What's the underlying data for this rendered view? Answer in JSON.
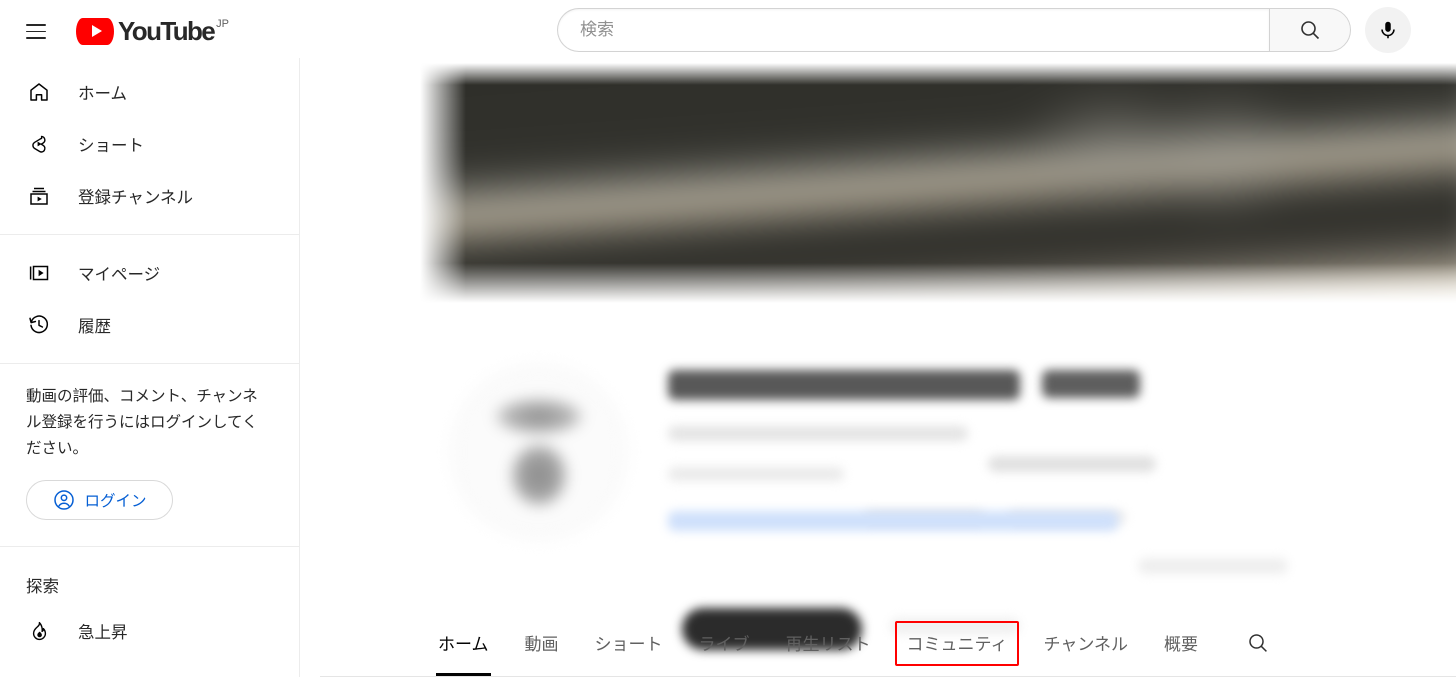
{
  "topbar": {
    "menu_icon": "hamburger-menu-icon",
    "logo_word": "YouTube",
    "logo_country": "JP",
    "search": {
      "placeholder": "検索",
      "value": "",
      "search_icon": "search-icon",
      "mic_icon": "microphone-icon"
    }
  },
  "sidebar": {
    "primary_items": [
      {
        "label": "ホーム",
        "icon": "home-icon"
      },
      {
        "label": "ショート",
        "icon": "shorts-icon"
      },
      {
        "label": "登録チャンネル",
        "icon": "subscriptions-icon"
      }
    ],
    "secondary_items": [
      {
        "label": "マイページ",
        "icon": "you-library-icon"
      },
      {
        "label": "履歴",
        "icon": "history-clock-icon"
      }
    ],
    "signin": {
      "message": "動画の評価、コメント、チャンネル登録を行うにはログインしてください。",
      "button_label": "ログイン",
      "button_icon": "account-circle-icon",
      "accent_color": "#065fd4"
    },
    "explore": {
      "section_title": "探索",
      "items": [
        {
          "label": "急上昇",
          "icon": "trending-flame-icon"
        }
      ]
    }
  },
  "channel": {
    "banner_alt": "blurred-channel-banner",
    "avatar_alt": "blurred-channel-avatar",
    "name_redacted": true,
    "subscribe_button_redacted": true
  },
  "tabs": {
    "items": [
      {
        "label": "ホーム",
        "active": true,
        "highlighted": false
      },
      {
        "label": "動画",
        "active": false,
        "highlighted": false
      },
      {
        "label": "ショート",
        "active": false,
        "highlighted": false
      },
      {
        "label": "ライブ",
        "active": false,
        "highlighted": false
      },
      {
        "label": "再生リスト",
        "active": false,
        "highlighted": false
      },
      {
        "label": "コミュニティ",
        "active": false,
        "highlighted": true
      },
      {
        "label": "チャンネル",
        "active": false,
        "highlighted": false
      },
      {
        "label": "概要",
        "active": false,
        "highlighted": false
      }
    ],
    "search_icon": "search-icon",
    "highlight_color": "#ff0000"
  }
}
